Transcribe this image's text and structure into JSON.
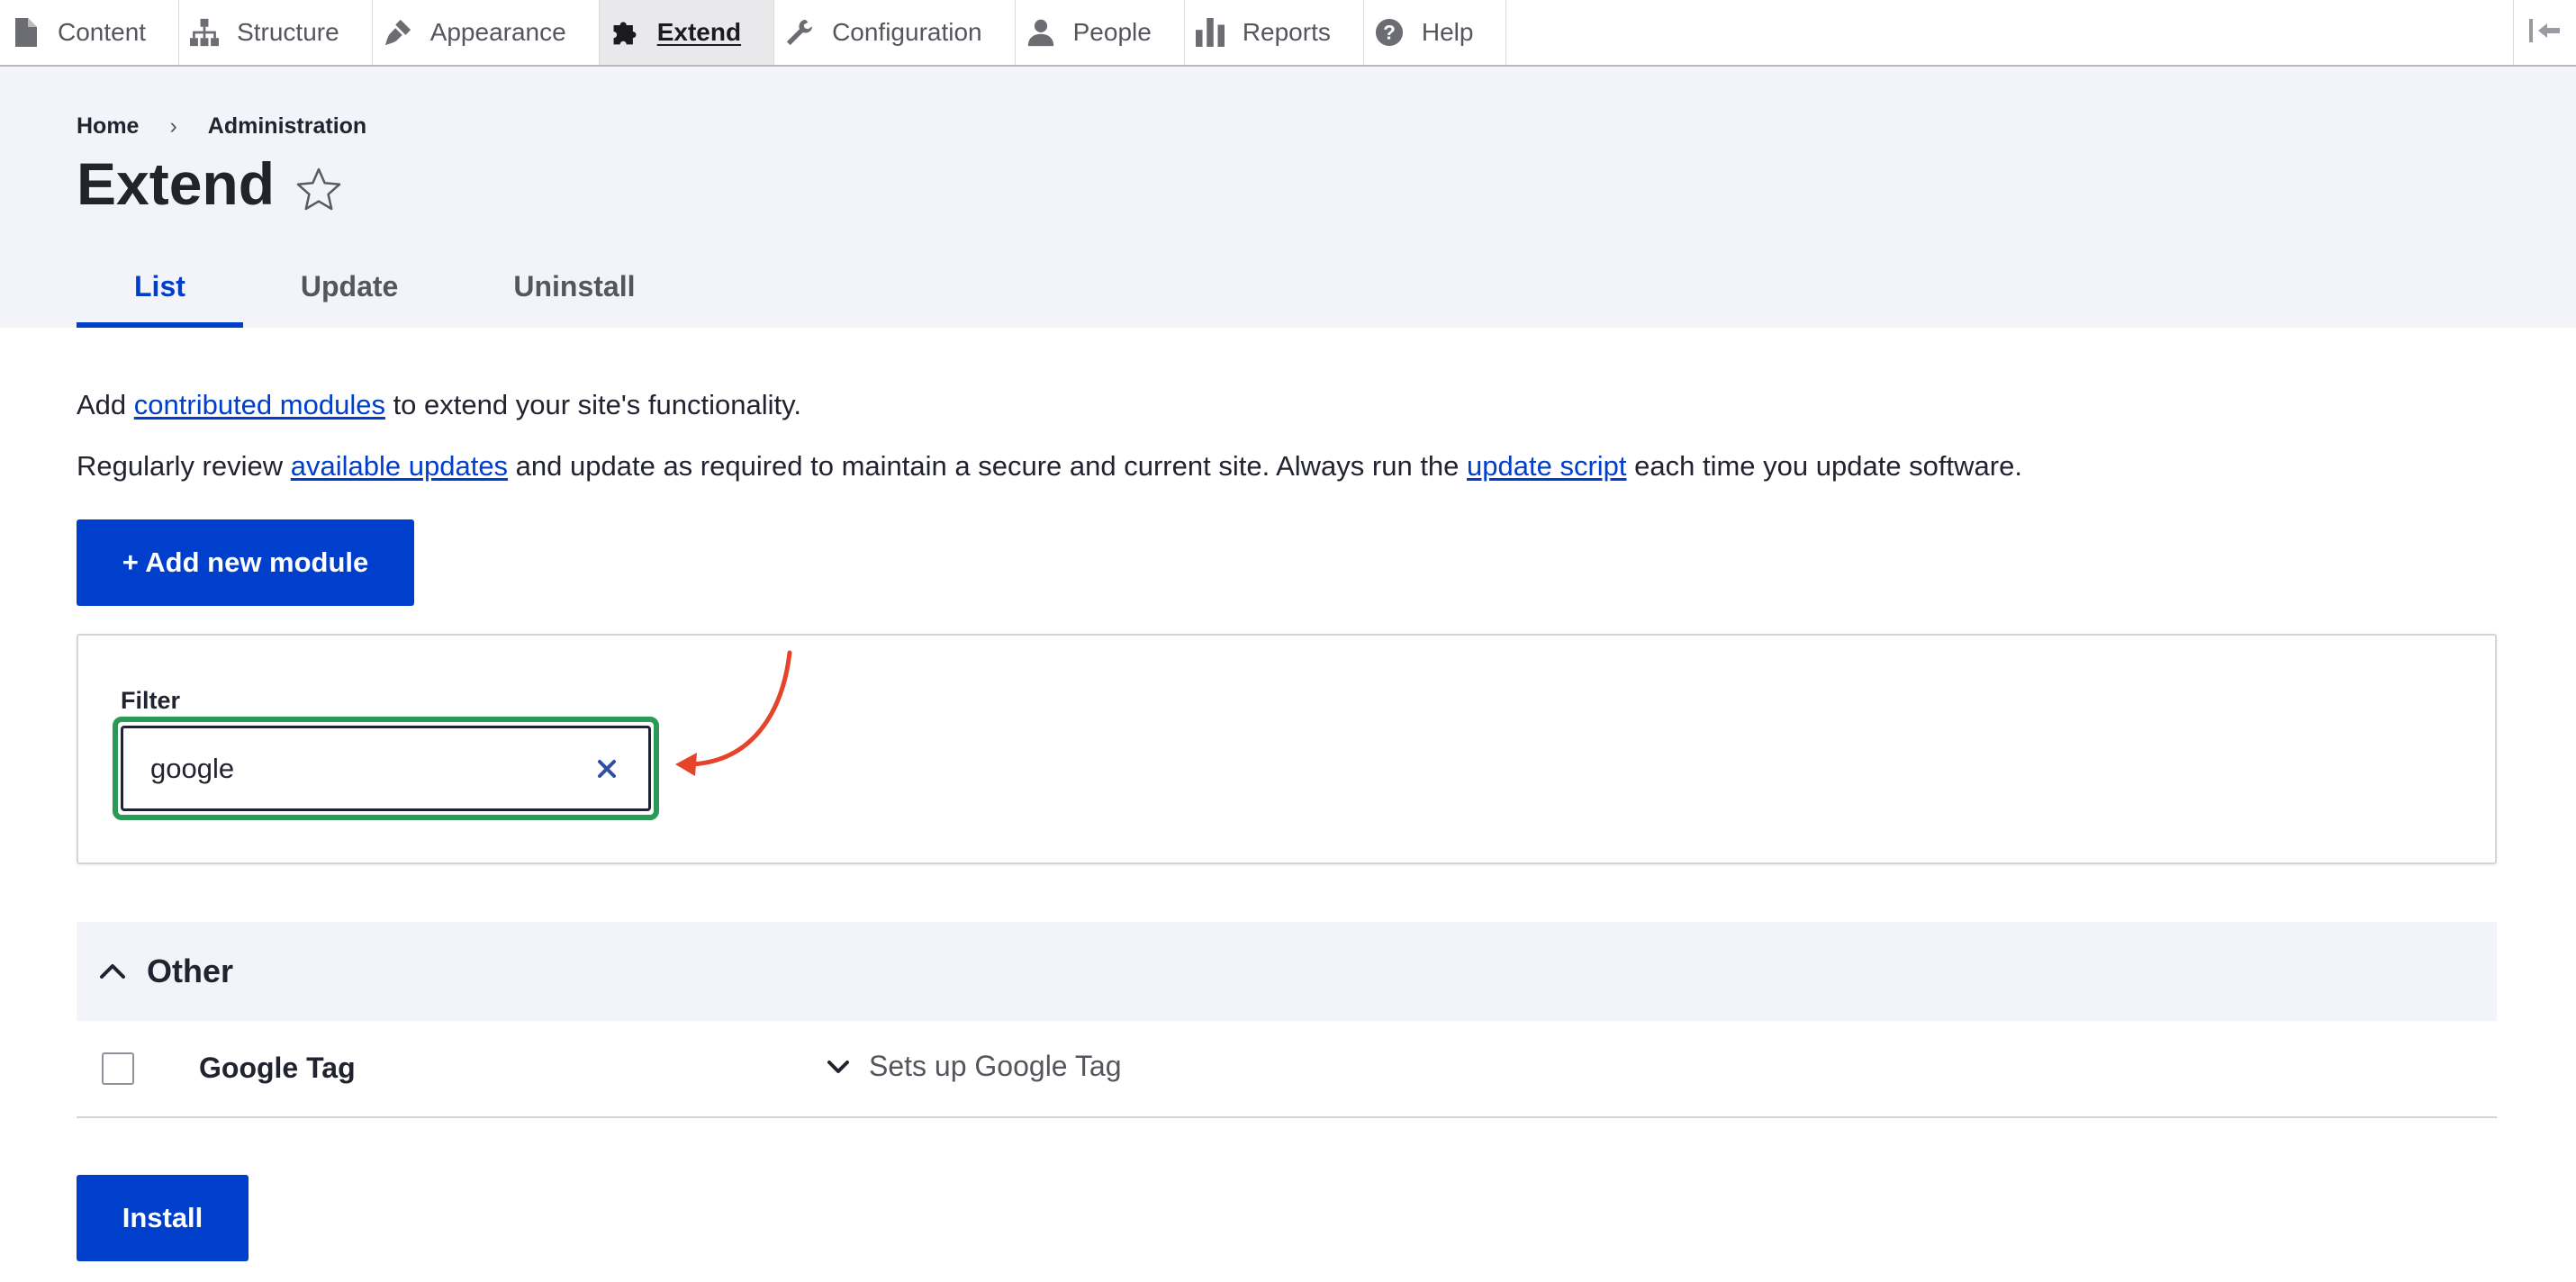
{
  "toolbar": {
    "items": [
      {
        "label": "Content",
        "icon": "file-icon"
      },
      {
        "label": "Structure",
        "icon": "sitemap-icon"
      },
      {
        "label": "Appearance",
        "icon": "paintbrush-icon"
      },
      {
        "label": "Extend",
        "icon": "puzzle-icon",
        "active": true
      },
      {
        "label": "Configuration",
        "icon": "wrench-icon"
      },
      {
        "label": "People",
        "icon": "person-icon"
      },
      {
        "label": "Reports",
        "icon": "bar-chart-icon"
      },
      {
        "label": "Help",
        "icon": "question-circle-icon"
      }
    ]
  },
  "breadcrumb": {
    "home": "Home",
    "separator": "›",
    "administration": "Administration"
  },
  "page": {
    "title": "Extend"
  },
  "tabs": [
    {
      "label": "List",
      "active": true
    },
    {
      "label": "Update"
    },
    {
      "label": "Uninstall"
    }
  ],
  "intro": {
    "line1_before": "Add ",
    "line1_link": "contributed modules",
    "line1_after": " to extend your site's functionality.",
    "line2_before": "Regularly review ",
    "line2_link1": "available updates",
    "line2_middle": " and update as required to maintain a secure and current site. Always run the ",
    "line2_link2": "update script",
    "line2_after": " each time you update software."
  },
  "add_module_button": "+ Add new module",
  "filter": {
    "label": "Filter",
    "value": "google"
  },
  "group": {
    "title": "Other"
  },
  "modules": [
    {
      "name": "Google Tag",
      "description": "Sets up Google Tag",
      "checked": false
    }
  ],
  "install_button": "Install",
  "colors": {
    "primary": "#003ecc",
    "focus_ring": "#2b9a57",
    "annotation_arrow": "#e5432a"
  }
}
